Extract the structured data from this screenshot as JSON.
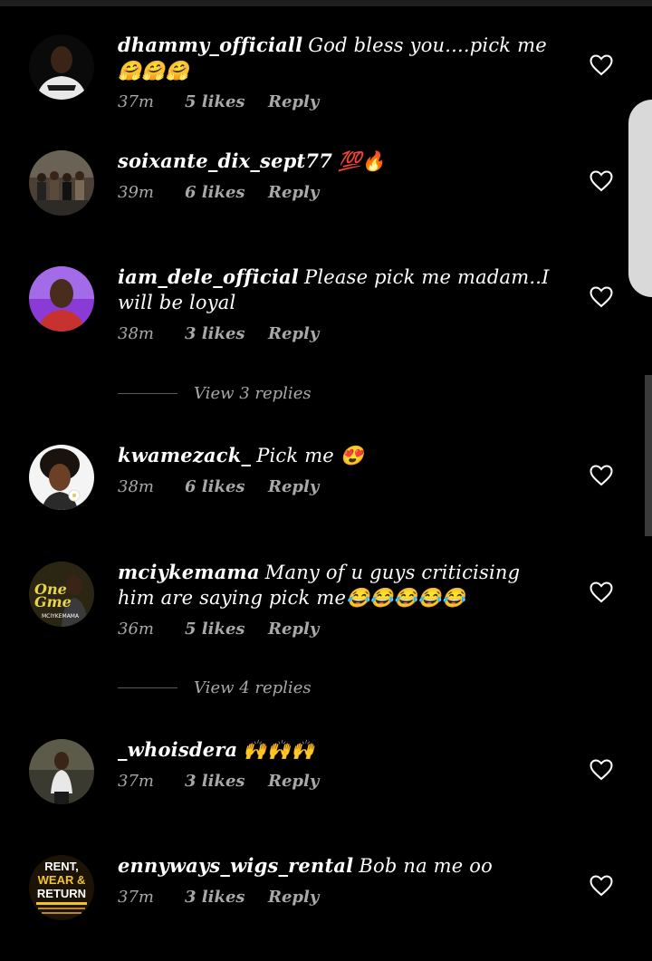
{
  "comments": [
    {
      "username": "dhammy_officiall",
      "text": "God bless you....pick me🤗🤗🤗",
      "time": "37m",
      "likes": "5 likes",
      "reply": "Reply"
    },
    {
      "username": "soixante_dix_sept77",
      "text": "💯🔥",
      "time": "39m",
      "likes": "6 likes",
      "reply": "Reply"
    },
    {
      "username": "iam_dele_official",
      "text": "Please pick me madam..I will be loyal",
      "time": "38m",
      "likes": "3 likes",
      "reply": "Reply",
      "view_replies": "View 3 replies"
    },
    {
      "username": "kwamezack_",
      "text": "Pick me 😍",
      "time": "38m",
      "likes": "6 likes",
      "reply": "Reply"
    },
    {
      "username": "mciykemama",
      "text": "Many of u guys criticising him are saying pick me😂😂😂😂😂",
      "time": "36m",
      "likes": "5 likes",
      "reply": "Reply",
      "view_replies": "View 4 replies"
    },
    {
      "username": "_whoisdera",
      "text": "🙌🙌🙌",
      "time": "37m",
      "likes": "3 likes",
      "reply": "Reply"
    },
    {
      "username": "ennyways_wigs_rental",
      "text": "Bob na me oo",
      "time": "37m",
      "likes": "3 likes",
      "reply": "Reply"
    }
  ],
  "avatars": {
    "mciykemama": {
      "line1": "One",
      "line2": "Gme",
      "line3": "MCIYKEMAMA"
    },
    "ennyways_wigs_rental": {
      "line1": "RENT,",
      "line2": "WEAR &",
      "line3": "RETURN"
    }
  },
  "icons": {
    "like": "heart-outline-icon"
  },
  "colors": {
    "background": "#000000",
    "meta_text": "#a8a8a8",
    "username_text": "#ffffff"
  }
}
